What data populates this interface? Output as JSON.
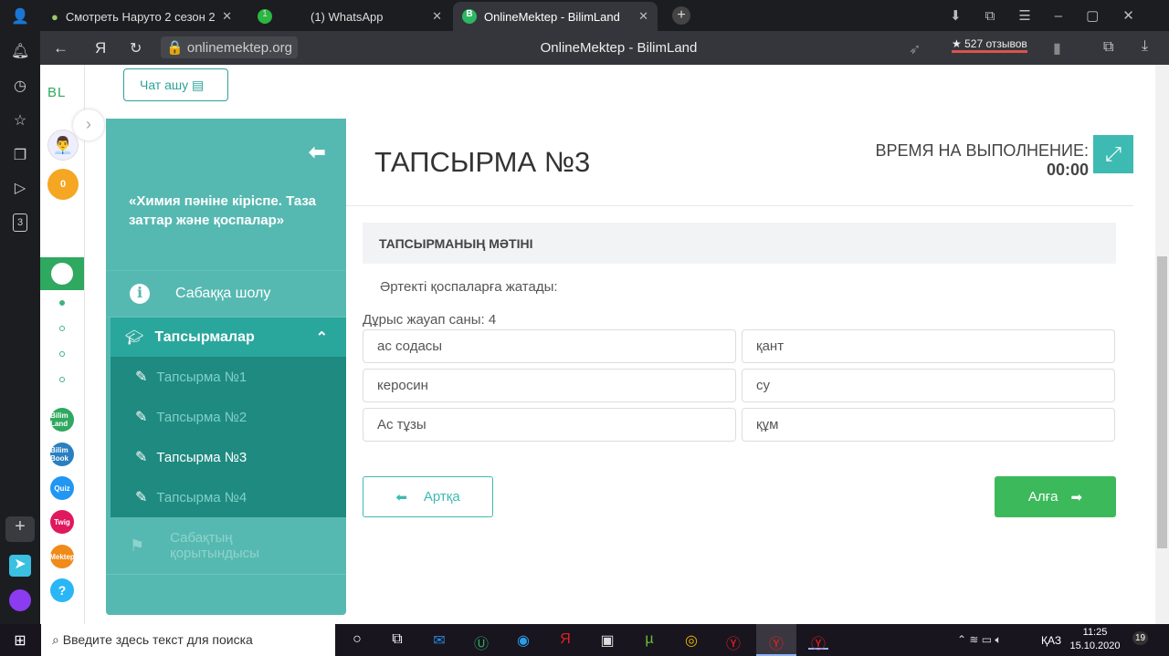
{
  "browser": {
    "tabs": [
      {
        "label": "Смотреть Наруто 2 сезон 2",
        "active": false
      },
      {
        "label": "(1) WhatsApp",
        "active": false,
        "badge": "1"
      },
      {
        "label": "OnlineMektep - BilimLand",
        "active": true
      }
    ],
    "url": "onlinemektep.org",
    "page_title": "OnlineMektep - BilimLand",
    "reviews": "★ 527 отзывов"
  },
  "left_bar": {
    "badge": "3"
  },
  "app_sidebar": {
    "logo": "BL",
    "coins": "0",
    "apps": [
      {
        "label": "Bilim Land",
        "color": "#2fa860"
      },
      {
        "label": "Bilim Book",
        "color": "#2a7fc0"
      },
      {
        "label": "Quiz",
        "color": "#2196f3"
      },
      {
        "label": "Twig",
        "color": "#e0185e"
      },
      {
        "label": "Mektep",
        "color": "#f08a1a"
      },
      {
        "label": "?",
        "color": "#29b6f6"
      }
    ]
  },
  "chat_button": "Чат ашу",
  "nav": {
    "lesson_title": "«Химия пәніне кіріспе. Таза заттар және қоспалар»",
    "overview": "Сабаққа шолу",
    "tasks": "Тапсырмалар",
    "task_items": [
      "Тапсырма №1",
      "Тапсырма №2",
      "Тапсырма №3",
      "Тапсырма №4"
    ],
    "active_task": 2,
    "summary": "Сабақтың қорытындысы"
  },
  "main": {
    "title": "ТАПСЫРМА №3",
    "timer_label": "ВРЕМЯ НА ВЫПОЛНЕНИЕ:",
    "timer_value": "00:00",
    "section_header": "ТАПСЫРМАНЫҢ МӘТІНІ",
    "question": "Әртекті қоспаларға жатады:",
    "correct_count": "Дұрыс жауап саны: 4",
    "options": [
      "ас содасы",
      "қант",
      "керосин",
      "су",
      "Ас тұзы",
      "құм"
    ],
    "back_label": "Артқа",
    "next_label": "Алға"
  },
  "taskbar": {
    "search_placeholder": "Введите здесь текст для поиска",
    "lang": "ҚАЗ",
    "time": "11:25",
    "date": "15.10.2020",
    "notifications": "19"
  }
}
